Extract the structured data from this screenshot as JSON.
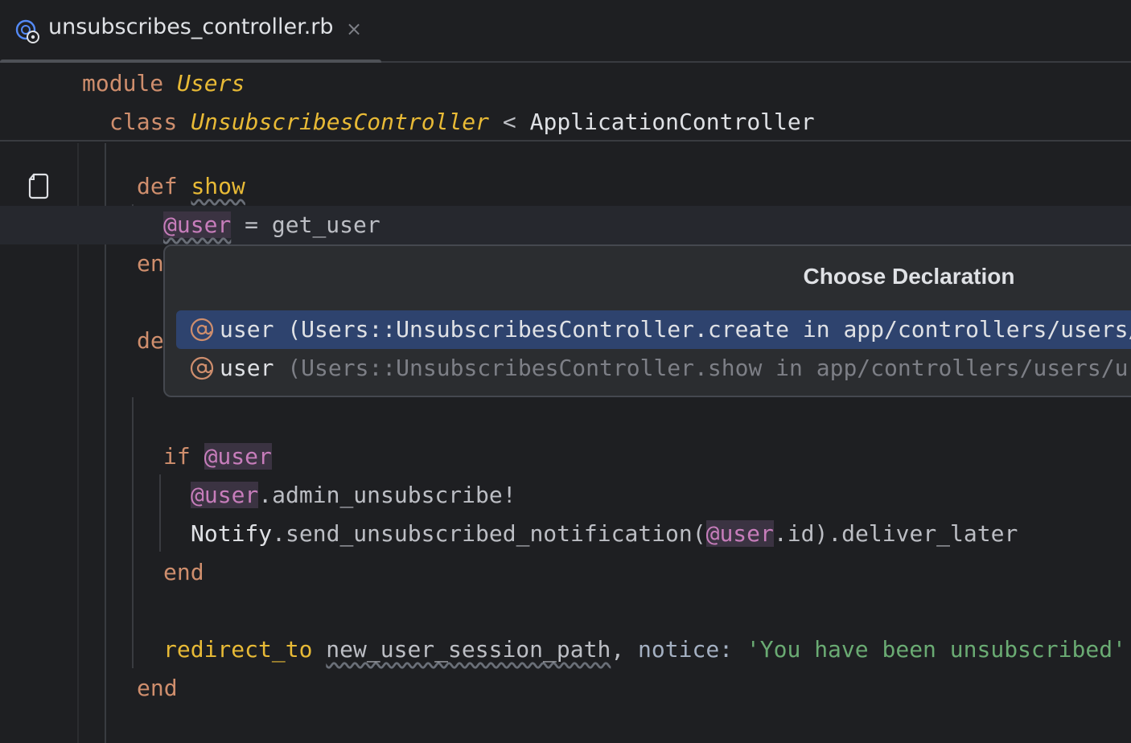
{
  "tab": {
    "title": "unsubscribes_controller.rb",
    "close_glyph": "×",
    "icon": "ruby-controller-file-icon"
  },
  "sticky": {
    "line1_kw": "module",
    "line1_name": "Users",
    "line2_kw": "class",
    "line2_name": "UnsubscribesController",
    "line2_op": "<",
    "line2_parent": "ApplicationController"
  },
  "code": {
    "def1_kw": "def",
    "def1_name": "show",
    "assign_ivar": "@user",
    "assign_op": "=",
    "assign_call": "get_user",
    "end1": "en",
    "def2_kw": "de",
    "if_kw": "if",
    "if_ivar": "@user",
    "call1_ivar": "@user",
    "call1_rest": ".admin_unsubscribe!",
    "call2_const": "Notify",
    "call2_method": ".send_unsubscribed_notification(",
    "call2_ivar": "@user",
    "call2_rest": ".id).deliver_later",
    "end_if": "end",
    "redirect_kw": "redirect_to",
    "redirect_path": "new_user_session_path",
    "redirect_comma": ",",
    "notice_key": "notice:",
    "notice_value": "'You have been unsubscribed'",
    "end_def": "end"
  },
  "popup": {
    "title": "Choose Declaration",
    "items": [
      {
        "name": "user",
        "location": "(Users::UnsubscribesController.create in app/controllers/users/",
        "selected": true,
        "icon": "instance-variable-icon"
      },
      {
        "name": "user",
        "location": "(Users::UnsubscribesController.show in app/controllers/users/ur",
        "selected": false,
        "icon": "instance-variable-icon"
      }
    ]
  },
  "colors": {
    "background": "#1e1f22",
    "keyword": "#cf8e6d",
    "class_name": "#e8ba36",
    "instance_var": "#c77dbb",
    "string": "#6aab73",
    "selection": "#2e436e"
  }
}
